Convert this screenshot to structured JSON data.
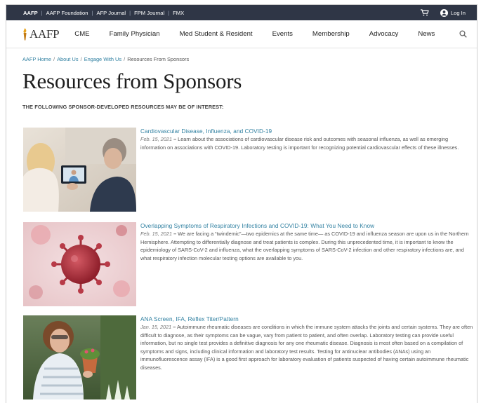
{
  "topbar": {
    "links": [
      "AAFP",
      "AAFP Foundation",
      "AFP Journal",
      "FPM Journal",
      "FMX"
    ],
    "login_label": "Log In",
    "cart_icon": "cart-icon",
    "user_icon": "user-icon"
  },
  "nav": {
    "logo_text": "AAFP",
    "items": [
      "CME",
      "Family Physician",
      "Med Student & Resident",
      "Events",
      "Membership",
      "Advocacy",
      "News"
    ],
    "search_icon": "search-icon"
  },
  "breadcrumb": {
    "items": [
      "AAFP Home",
      "About Us",
      "Engage With Us"
    ],
    "current": "Resources From Sponsors"
  },
  "page": {
    "title": "Resources from Sponsors",
    "intro": "THE FOLLOWING SPONSOR-DEVELOPED RESOURCES MAY BE OF INTEREST:"
  },
  "articles": [
    {
      "title": "Cardiovascular Disease, Influenza, and COVID-19",
      "date": "Feb. 15, 2021",
      "dash": "–",
      "summary": "Learn about the associations of cardiovascular disease risk and outcomes with seasonal influenza, as well as emerging information on associations with COVID-19. Laboratory testing is important for recognizing potential cardiovascular effects of these illnesses."
    },
    {
      "title": "Overlapping Symptoms of Respiratory Infections and COVID-19: What You Need to Know",
      "date": "Feb. 15, 2021",
      "dash": "–",
      "summary": "We are facing a “twindemic”—two epidemics at the same time— as COVID-19 and influenza season are upon us in the Northern Hemisphere. Attempting to differentially diagnose and treat patients is complex. During this unprecedented time, it is important to know the epidemiology of SARS-CoV-2 and influenza, what the overlapping symptoms of SARS-CoV-2 infection and other respiratory infections are, and what respiratory infection molecular testing options are available to you."
    },
    {
      "title": "ANA Screen, IFA, Reflex Titer/Pattern",
      "date": "Jan. 15, 2021",
      "dash": "–",
      "summary": "Autoimmune rheumatic diseases are conditions in which the immune system attacks the joints and certain systems. They are often difficult to diagnose, as their symptoms can be vague, vary from patient to patient, and often overlap. Laboratory testing can provide useful information, but no single test provides a definitive diagnosis for any one rheumatic disease. Diagnosis is most often based on a compilation of symptoms and signs, including clinical information and laboratory test results. Testing for antinuclear antibodies (ANAs) using an immunofluorescence assay (IFA) is a good first approach for laboratory evaluation of patients suspected of having certain autoimmune rheumatic diseases."
    }
  ]
}
